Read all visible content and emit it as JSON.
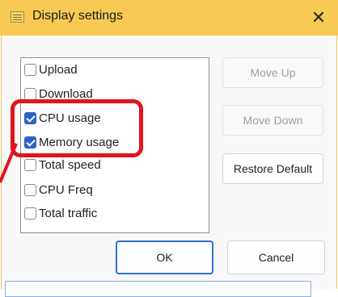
{
  "window": {
    "title": "Display settings",
    "close_label": "✕"
  },
  "list": {
    "items": [
      {
        "label": "Upload",
        "checked": false
      },
      {
        "label": "Download",
        "checked": false
      },
      {
        "label": "CPU usage",
        "checked": true
      },
      {
        "label": "Memory usage",
        "checked": true
      },
      {
        "label": "Total speed",
        "checked": false
      },
      {
        "label": "CPU Freq",
        "checked": false
      },
      {
        "label": "Total traffic",
        "checked": false
      }
    ]
  },
  "side_buttons": {
    "move_up": "Move Up",
    "move_down": "Move Down",
    "restore_default": "Restore Default"
  },
  "footer": {
    "ok": "OK",
    "cancel": "Cancel"
  },
  "colors": {
    "titlebar": "#f8ca53",
    "annotation": "#e2141c",
    "checkbox_checked": "#2b63c4"
  },
  "icons": {
    "app": "settings-window-icon",
    "close": "close-icon"
  }
}
